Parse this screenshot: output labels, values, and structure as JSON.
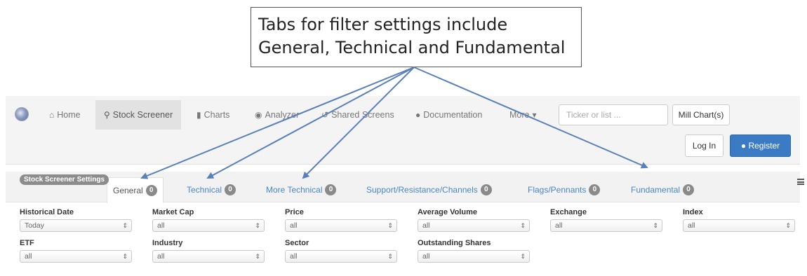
{
  "callout": {
    "line1": "Tabs for filter settings include",
    "line2": "General, Technical and Fundamental"
  },
  "nav": {
    "items": [
      {
        "label": "Home",
        "icon": "home-icon"
      },
      {
        "label": "Stock Screener",
        "icon": "search-icon"
      },
      {
        "label": "Charts",
        "icon": "bar-chart-icon"
      },
      {
        "label": "Analyzer",
        "icon": "eye-icon"
      },
      {
        "label": "Shared Screens",
        "icon": "share-icon"
      },
      {
        "label": "Documentation",
        "icon": "info-icon"
      },
      {
        "label": "More",
        "icon": "caret-down-icon"
      }
    ],
    "ticker_placeholder": "Ticker or list ...",
    "mill_chart_label": "Mill Chart(s)",
    "login_label": "Log In",
    "register_label": "Register"
  },
  "settings": {
    "title": "Stock Screener Settings",
    "tabs": [
      {
        "label": "General",
        "count": "0"
      },
      {
        "label": "Technical",
        "count": "0"
      },
      {
        "label": "More Technical",
        "count": "0"
      },
      {
        "label": "Support/Resistance/Channels",
        "count": "0"
      },
      {
        "label": "Flags/Pennants",
        "count": "0"
      },
      {
        "label": "Fundamental",
        "count": "0"
      }
    ],
    "filters_row1": [
      {
        "label": "Historical Date",
        "value": "Today"
      },
      {
        "label": "Market Cap",
        "value": "all"
      },
      {
        "label": "Price",
        "value": "all"
      },
      {
        "label": "Average Volume",
        "value": "all"
      },
      {
        "label": "Exchange",
        "value": "all"
      },
      {
        "label": "Index",
        "value": "all"
      }
    ],
    "filters_row2": [
      {
        "label": "ETF",
        "value": "all"
      },
      {
        "label": "Industry",
        "value": "all"
      },
      {
        "label": "Sector",
        "value": "all"
      },
      {
        "label": "Outstanding Shares",
        "value": "all"
      }
    ]
  },
  "colors": {
    "accent": "#4a86c8",
    "register_bg": "#3b7bc4",
    "arrow": "#5a80b8",
    "badge": "#8a8a8a"
  }
}
